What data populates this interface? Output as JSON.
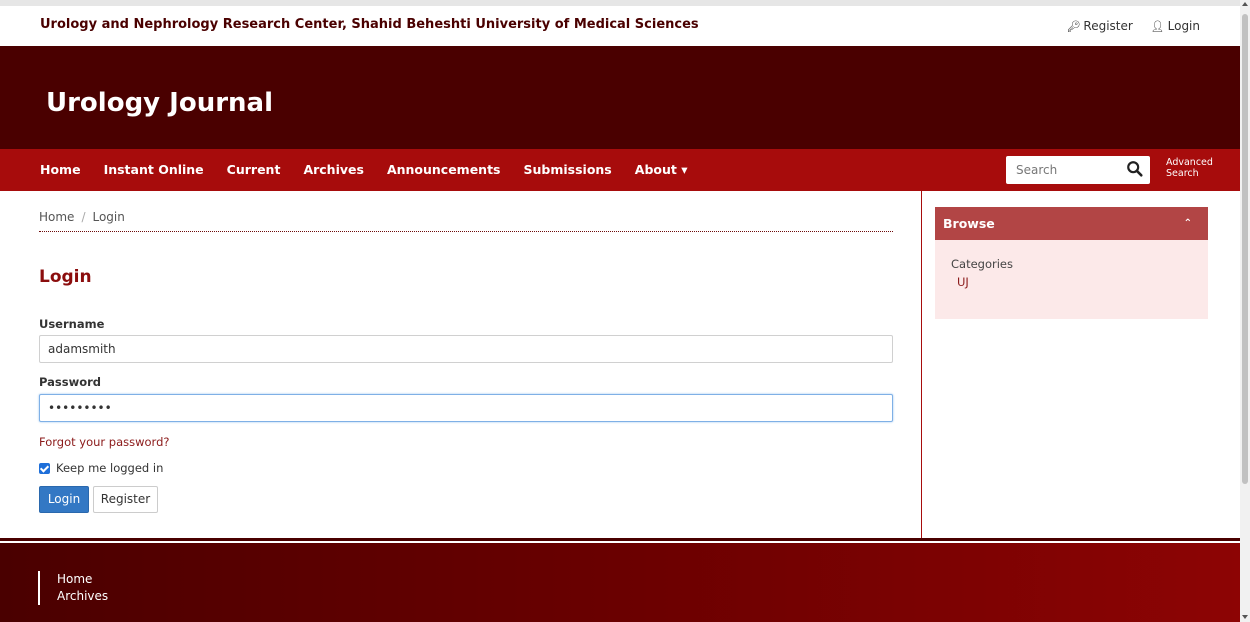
{
  "header": {
    "site_name": "Urology and Nephrology Research Center, Shahid Beheshti University of Medical Sciences",
    "register_label": "Register",
    "login_label": "Login"
  },
  "banner": {
    "journal_title": "Urology Journal"
  },
  "nav": {
    "items": [
      "Home",
      "Instant Online",
      "Current",
      "Archives",
      "Announcements",
      "Submissions",
      "About ▾"
    ],
    "search_placeholder": "Search",
    "advanced_line1": "Advanced",
    "advanced_line2": "Search"
  },
  "breadcrumb": {
    "home": "Home",
    "sep": "/",
    "current": "Login"
  },
  "login": {
    "title": "Login",
    "username_label": "Username",
    "username_value": "adamsmith",
    "password_label": "Password",
    "password_value": "adamsmith",
    "forgot": "Forgot your password?",
    "remember": "Keep me logged in",
    "login_button": "Login",
    "register_button": "Register"
  },
  "sidebar": {
    "browse_title": "Browse",
    "chevron": "⌃",
    "categories_label": "Categories",
    "category_item": "UJ"
  },
  "footer": {
    "links": [
      "Home",
      "Archives"
    ]
  },
  "colors": {
    "dark_red": "#4a0000",
    "nav_red": "#a70c0c",
    "panel_header": "#b24545",
    "panel_bg": "#fce9e9",
    "primary_button": "#3378c4"
  },
  "icons": {
    "register": "key-icon",
    "login": "user-icon",
    "search": "search-icon"
  }
}
